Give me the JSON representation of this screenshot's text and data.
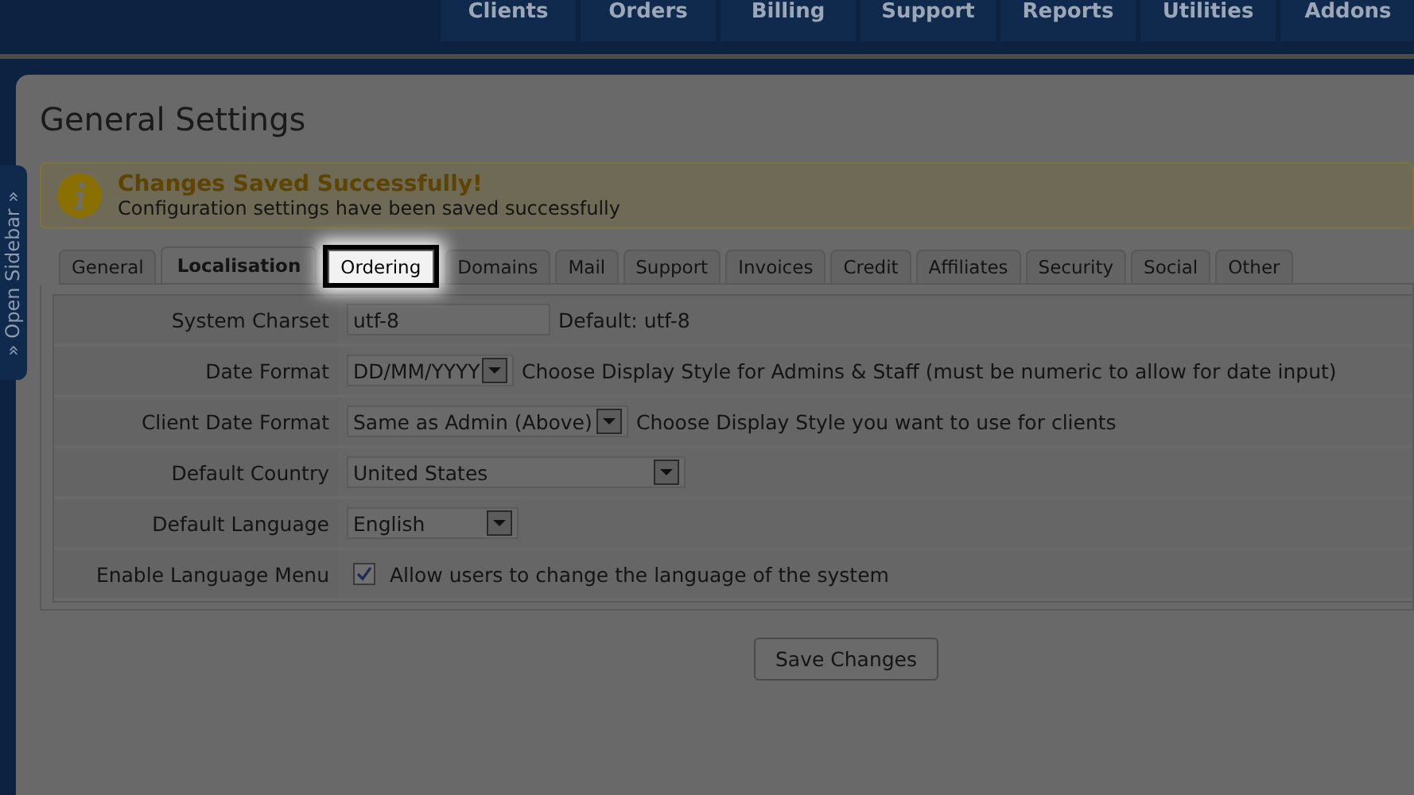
{
  "nav": {
    "items": [
      "Clients",
      "Orders",
      "Billing",
      "Support",
      "Reports",
      "Utilities",
      "Addons"
    ]
  },
  "sidebar_toggle": {
    "label": "» Open Sidebar »"
  },
  "page": {
    "title": "General Settings"
  },
  "alert": {
    "title": "Changes Saved Successfully!",
    "message": "Configuration settings have been saved successfully"
  },
  "tabs": [
    {
      "label": "General",
      "selected": false,
      "spotlight": false
    },
    {
      "label": "Localisation",
      "selected": true,
      "spotlight": false
    },
    {
      "label": "Ordering",
      "selected": false,
      "spotlight": true
    },
    {
      "label": "Domains",
      "selected": false,
      "spotlight": false
    },
    {
      "label": "Mail",
      "selected": false,
      "spotlight": false
    },
    {
      "label": "Support",
      "selected": false,
      "spotlight": false
    },
    {
      "label": "Invoices",
      "selected": false,
      "spotlight": false
    },
    {
      "label": "Credit",
      "selected": false,
      "spotlight": false
    },
    {
      "label": "Affiliates",
      "selected": false,
      "spotlight": false
    },
    {
      "label": "Security",
      "selected": false,
      "spotlight": false
    },
    {
      "label": "Social",
      "selected": false,
      "spotlight": false
    },
    {
      "label": "Other",
      "selected": false,
      "spotlight": false
    }
  ],
  "settings": [
    {
      "label": "System Charset",
      "kind": "text",
      "value": "utf-8",
      "note": "Default: utf-8"
    },
    {
      "label": "Date Format",
      "kind": "select",
      "value": "DD/MM/YYYY",
      "note": "Choose Display Style for Admins & Staff (must be numeric to allow for date input)"
    },
    {
      "label": "Client Date Format",
      "kind": "select",
      "value": "Same as Admin (Above)",
      "note": "Choose Display Style you want to use for clients"
    },
    {
      "label": "Default Country",
      "kind": "select",
      "value": "United States"
    },
    {
      "label": "Default Language",
      "kind": "select",
      "value": "English"
    },
    {
      "label": "Enable Language Menu",
      "kind": "checkbox",
      "checked": true,
      "note": "Allow users to change the language of the system"
    }
  ],
  "save_button": "Save Changes"
}
